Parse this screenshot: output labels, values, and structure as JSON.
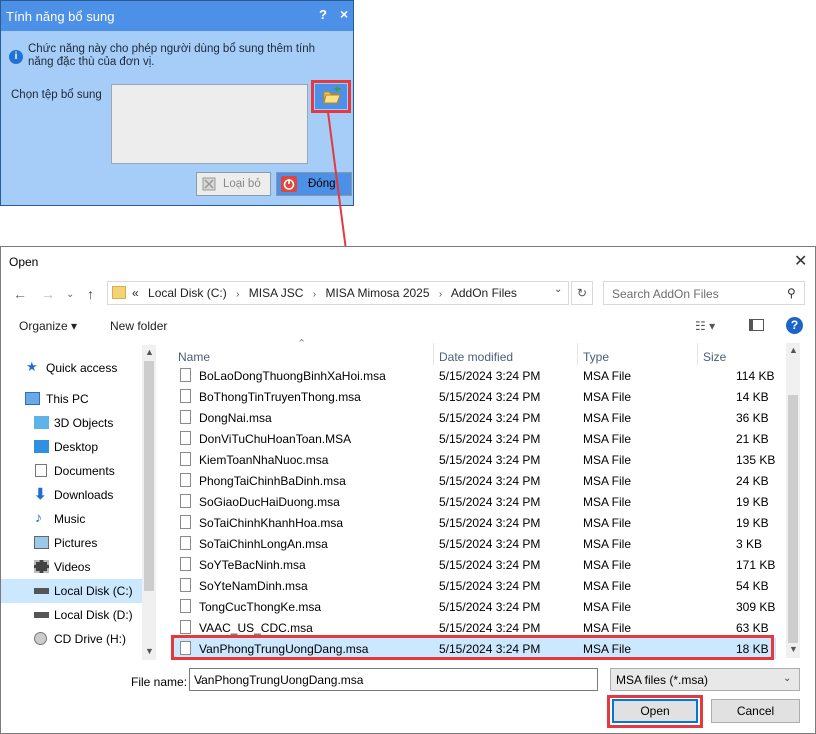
{
  "addon_dialog": {
    "title": "Tính năng bổ sung",
    "help": "?",
    "close": "×",
    "description": "Chức năng này cho phép người dùng bổ sung thêm tính năng đặc thù của đơn vị.",
    "file_label": "Chọn tệp bổ sung",
    "remove_label": "Loại bỏ",
    "close_label": "Đóng"
  },
  "open_dialog": {
    "title": "Open",
    "close": "✕",
    "address": {
      "prefix": "«",
      "crumbs": [
        "Local Disk (C:)",
        "MISA JSC",
        "MISA Mimosa 2025",
        "AddOn Files"
      ]
    },
    "search_placeholder": "Search AddOn Files",
    "organize_label": "Organize ▾",
    "new_folder_label": "New folder",
    "sidebar": [
      {
        "label": "Quick access",
        "icon": "star-icon"
      },
      {
        "label": "This PC",
        "icon": "pc-icon"
      },
      {
        "label": "3D Objects",
        "icon": "cube-icon"
      },
      {
        "label": "Desktop",
        "icon": "desktop-icon"
      },
      {
        "label": "Documents",
        "icon": "documents-icon"
      },
      {
        "label": "Downloads",
        "icon": "download-icon"
      },
      {
        "label": "Music",
        "icon": "music-icon"
      },
      {
        "label": "Pictures",
        "icon": "pictures-icon"
      },
      {
        "label": "Videos",
        "icon": "videos-icon"
      },
      {
        "label": "Local Disk (C:)",
        "icon": "drive-icon"
      },
      {
        "label": "Local Disk (D:)",
        "icon": "drive-icon"
      },
      {
        "label": "CD Drive (H:)",
        "icon": "cd-icon"
      }
    ],
    "columns": {
      "name": "Name",
      "date": "Date modified",
      "type": "Type",
      "size": "Size"
    },
    "files": [
      {
        "name": "BoLaoDongThuongBinhXaHoi.msa",
        "date": "5/15/2024 3:24 PM",
        "type": "MSA File",
        "size": "114 KB"
      },
      {
        "name": "BoThongTinTruyenThong.msa",
        "date": "5/15/2024 3:24 PM",
        "type": "MSA File",
        "size": "14 KB"
      },
      {
        "name": "DongNai.msa",
        "date": "5/15/2024 3:24 PM",
        "type": "MSA File",
        "size": "36 KB"
      },
      {
        "name": "DonViTuChuHoanToan.MSA",
        "date": "5/15/2024 3:24 PM",
        "type": "MSA File",
        "size": "21 KB"
      },
      {
        "name": "KiemToanNhaNuoc.msa",
        "date": "5/15/2024 3:24 PM",
        "type": "MSA File",
        "size": "135 KB"
      },
      {
        "name": "PhongTaiChinhBaDinh.msa",
        "date": "5/15/2024 3:24 PM",
        "type": "MSA File",
        "size": "24 KB"
      },
      {
        "name": "SoGiaoDucHaiDuong.msa",
        "date": "5/15/2024 3:24 PM",
        "type": "MSA File",
        "size": "19 KB"
      },
      {
        "name": "SoTaiChinhKhanhHoa.msa",
        "date": "5/15/2024 3:24 PM",
        "type": "MSA File",
        "size": "19 KB"
      },
      {
        "name": "SoTaiChinhLongAn.msa",
        "date": "5/15/2024 3:24 PM",
        "type": "MSA File",
        "size": "3 KB"
      },
      {
        "name": "SoYTeBacNinh.msa",
        "date": "5/15/2024 3:24 PM",
        "type": "MSA File",
        "size": "171 KB"
      },
      {
        "name": "SoYteNamDinh.msa",
        "date": "5/15/2024 3:24 PM",
        "type": "MSA File",
        "size": "54 KB"
      },
      {
        "name": "TongCucThongKe.msa",
        "date": "5/15/2024 3:24 PM",
        "type": "MSA File",
        "size": "309 KB"
      },
      {
        "name": "VAAC_US_CDC.msa",
        "date": "5/15/2024 3:24 PM",
        "type": "MSA File",
        "size": "63 KB"
      },
      {
        "name": "VanPhongTrungUongDang.msa",
        "date": "5/15/2024 3:24 PM",
        "type": "MSA File",
        "size": "18 KB"
      }
    ],
    "file_name_label": "File name:",
    "file_name_value": "VanPhongTrungUongDang.msa",
    "file_type_value": "MSA files (*.msa)",
    "open_label": "Open",
    "cancel_label": "Cancel"
  },
  "colors": {
    "highlight": "#e3393f",
    "addon_bg": "#a6cdf7",
    "addon_title": "#4d90e8",
    "selection": "#cce8ff"
  }
}
